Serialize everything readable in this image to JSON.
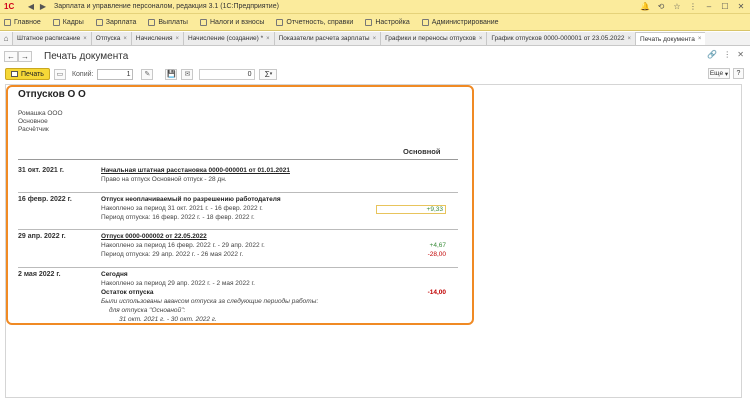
{
  "titlebar": {
    "logo": "1С",
    "app_title": "Зарплата и управление персоналом, редакция 3.1  (1С:Предприятие)"
  },
  "menu": [
    {
      "label": "Главное",
      "icon": "menu-icon"
    },
    {
      "label": "Кадры",
      "icon": "people-icon"
    },
    {
      "label": "Зарплата",
      "icon": "salary-icon"
    },
    {
      "label": "Выплаты",
      "icon": "payments-icon"
    },
    {
      "label": "Налоги и взносы",
      "icon": "taxes-icon"
    },
    {
      "label": "Отчетность, справки",
      "icon": "reports-icon"
    },
    {
      "label": "Настройка",
      "icon": "gear-icon"
    },
    {
      "label": "Администрирование",
      "icon": "admin-icon"
    }
  ],
  "tabs": [
    {
      "label": "Штатное расписание"
    },
    {
      "label": "Отпуска"
    },
    {
      "label": "Начисления"
    },
    {
      "label": "Начисление (создание) *"
    },
    {
      "label": "Показатели расчета зарплаты"
    },
    {
      "label": "Графики и переносы отпусков"
    },
    {
      "label": "График отпусков 0000-000001 от 23.05.2022"
    },
    {
      "label": "Печать документа",
      "active": true
    }
  ],
  "doc": {
    "title": "Печать документа"
  },
  "toolbar": {
    "print_label": "Печать",
    "copies_label": "Копий:",
    "copies_value": "1",
    "sum_value": "0",
    "sigma": "Σ",
    "more_label": "Еще"
  },
  "report": {
    "title": "Отпусков О О",
    "org_lines": [
      "Ромашка ООО",
      "Основное",
      "Расчётчик"
    ],
    "column_header": "Основной",
    "blocks": [
      {
        "date": "31 окт. 2021 г.",
        "lines": [
          {
            "text": "Начальная штатная расстановка 0000-000001 от 01.01.2021",
            "style": "bold under"
          },
          {
            "text": "Право на отпуск Основной отпуск - 28 дн.",
            "style": ""
          }
        ],
        "values": []
      },
      {
        "date": "16 февр. 2022 г.",
        "lines": [
          {
            "text": "Отпуск неоплачиваемый по разрешению работодателя",
            "style": "bold"
          },
          {
            "text": "Накоплено за период 31 окт. 2021 г. - 16 февр. 2022 г.",
            "style": ""
          },
          {
            "text": "Период отпуска: 16 февр. 2022 г. - 18 февр. 2022 г.",
            "style": ""
          }
        ],
        "values": [
          {
            "text": "+9,33",
            "line": 1,
            "color": "green",
            "boxed": true
          }
        ]
      },
      {
        "date": "29 апр. 2022 г.",
        "lines": [
          {
            "text": "Отпуск 0000-000002 от 22.05.2022",
            "style": "bold under"
          },
          {
            "text": "Накоплено за период 16 февр. 2022 г. - 29 апр. 2022 г.",
            "style": ""
          },
          {
            "text": "Период отпуска: 29 апр. 2022 г. - 26 мая 2022 г.",
            "style": ""
          }
        ],
        "values": [
          {
            "text": "+4,67",
            "line": 1,
            "color": "green"
          },
          {
            "text": "-28,00",
            "line": 2,
            "color": "red"
          }
        ]
      },
      {
        "date": "2 мая 2022 г.",
        "lines": [
          {
            "text": "Сегодня",
            "style": "bold"
          },
          {
            "text": "Накоплено за период 29 апр. 2022 г. - 2 мая 2022 г.",
            "style": ""
          },
          {
            "text": "Остаток отпуска",
            "style": "bold"
          },
          {
            "text": "Были использованы авансом отпуска за следующие периоды работы:",
            "style": "italic"
          },
          {
            "text": "для отпуска \"Основной\":",
            "style": "italic indent1"
          },
          {
            "text": "31 окт. 2021 г. - 30 окт. 2022 г.",
            "style": "italic indent2"
          }
        ],
        "values": [
          {
            "text": "-14,00",
            "line": 2,
            "color": "red",
            "bold": true
          }
        ]
      }
    ]
  }
}
